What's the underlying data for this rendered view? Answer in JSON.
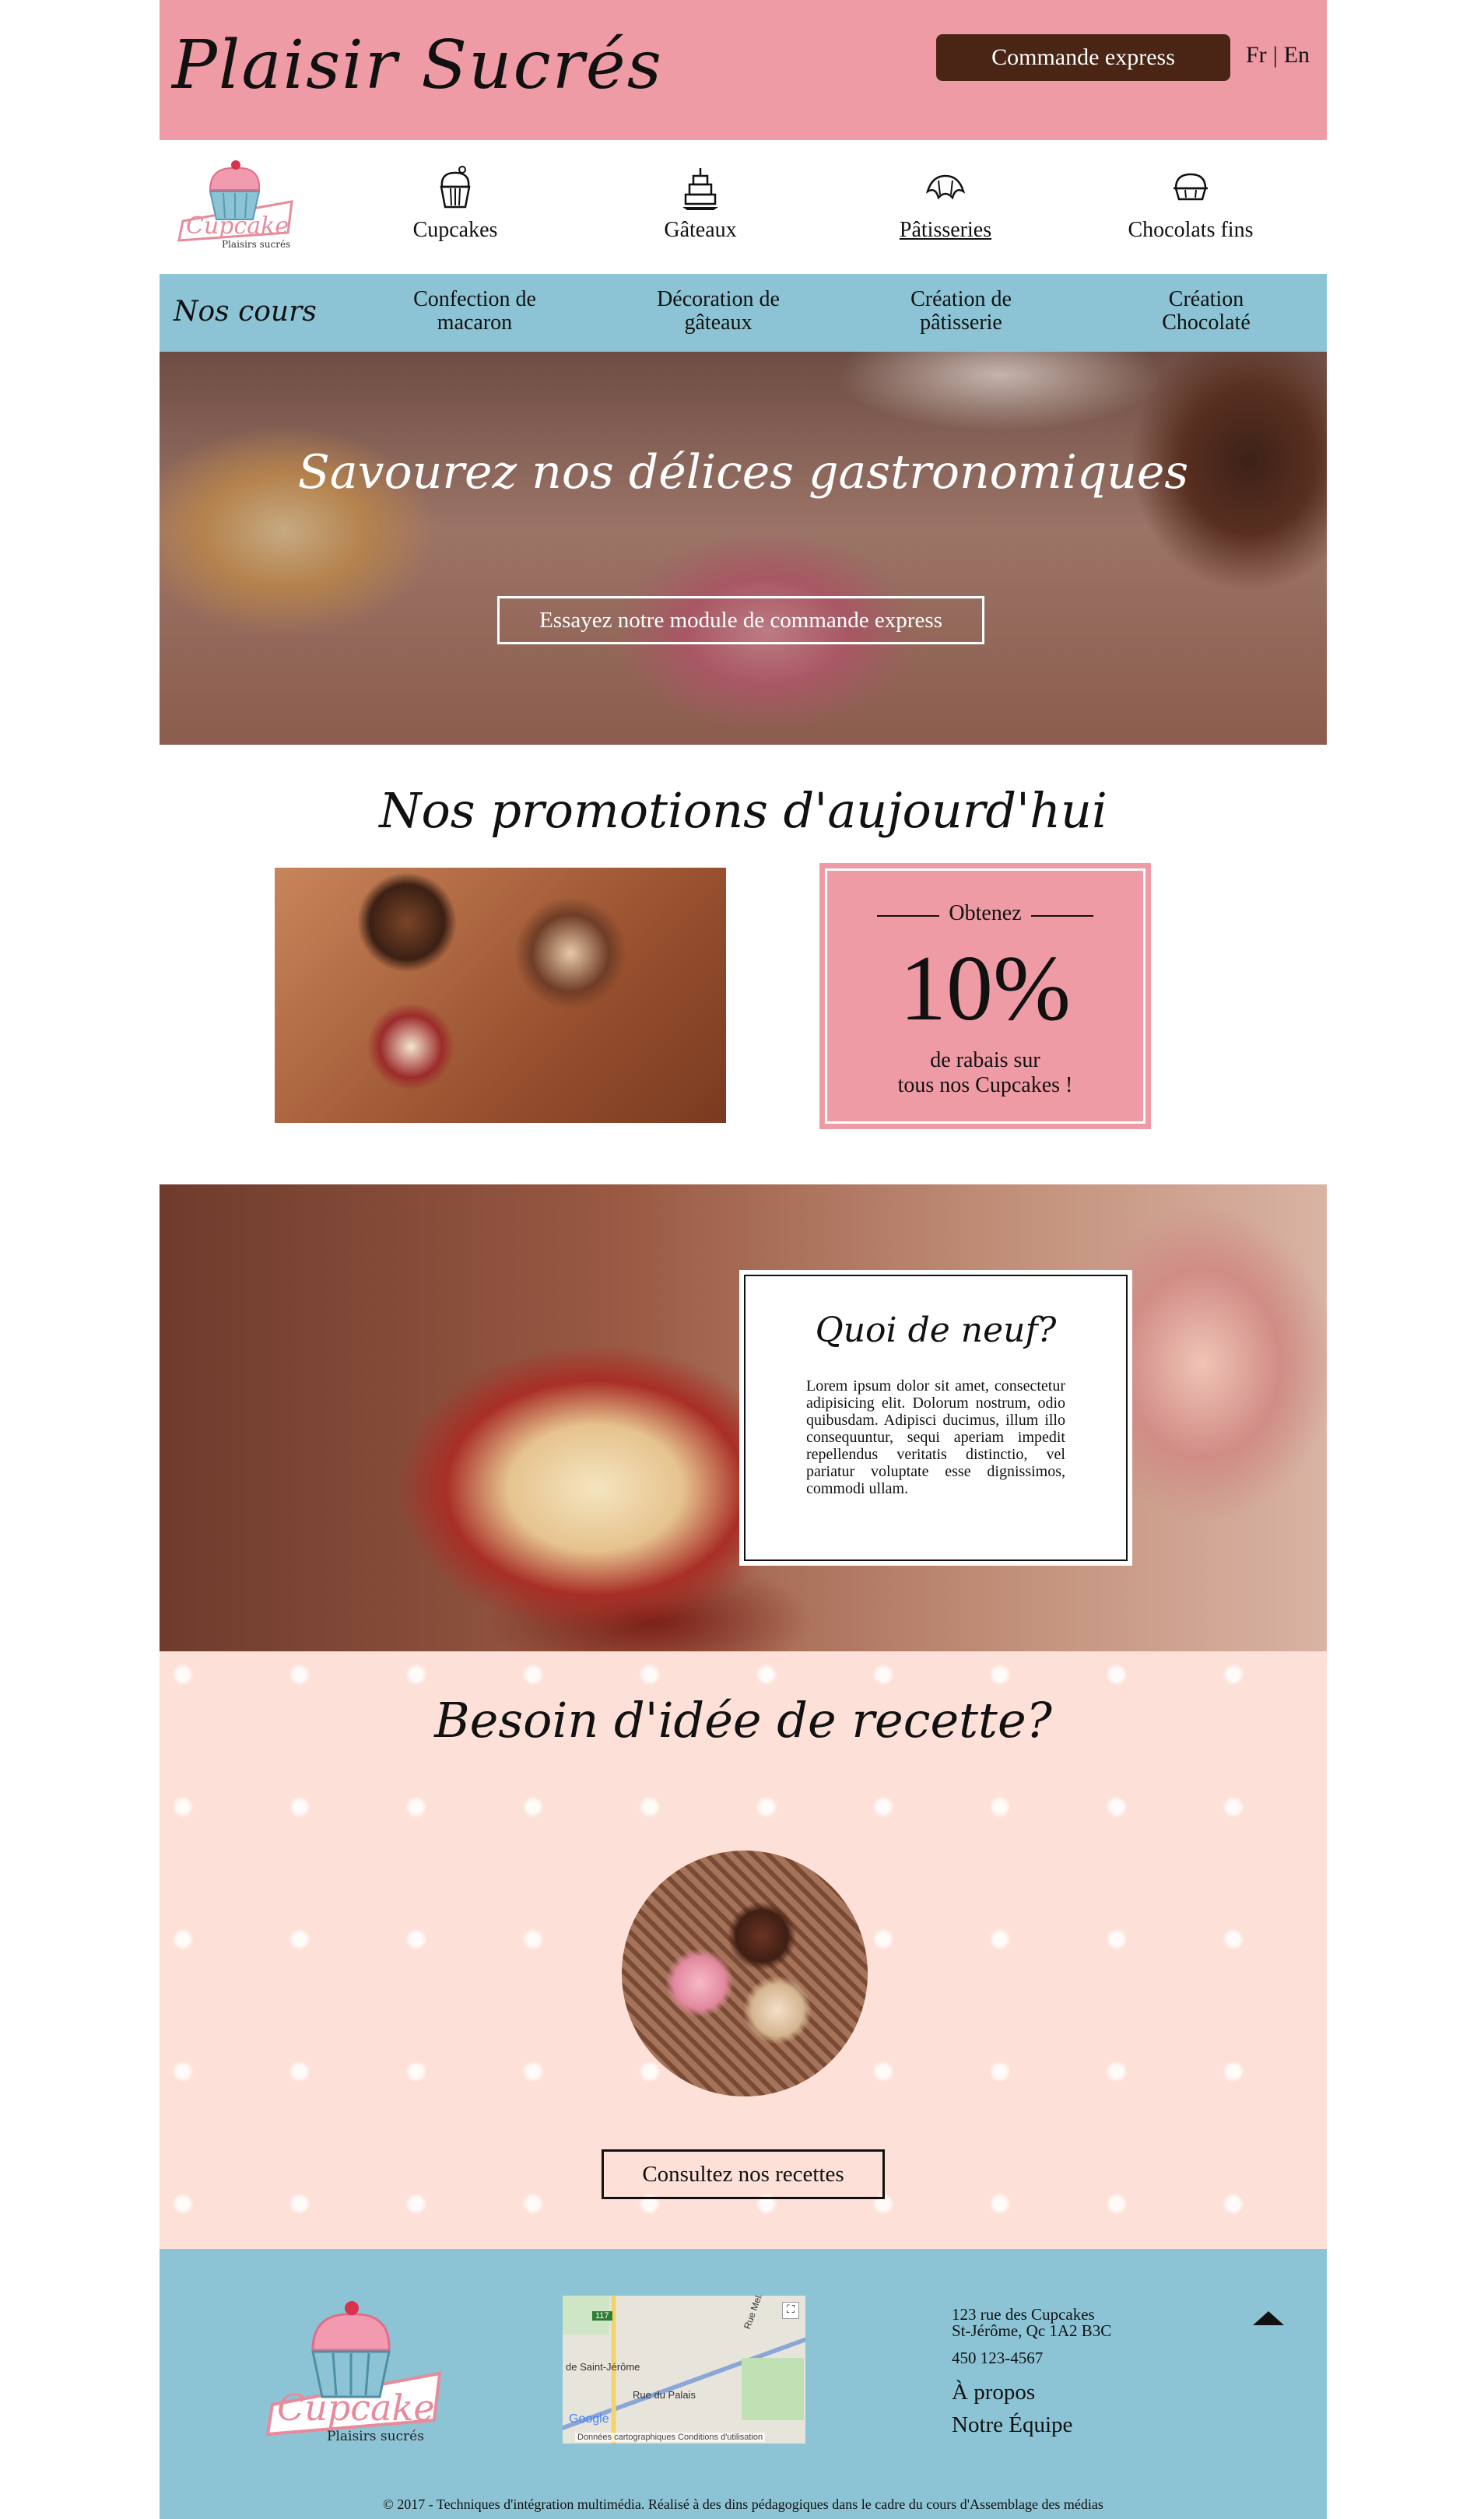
{
  "header": {
    "title": "Plaisir Sucrés",
    "express_button": "Commande express",
    "lang_fr": "Fr",
    "lang_sep": "|",
    "lang_en": "En"
  },
  "logo": {
    "word": "Cupcake",
    "tagline": "Plaisirs sucrés"
  },
  "categories": [
    {
      "label": "Cupcakes",
      "icon": "cupcake-icon"
    },
    {
      "label": "Gâteaux",
      "icon": "cake-icon"
    },
    {
      "label": "Pâtisseries",
      "icon": "croissant-icon",
      "active": true
    },
    {
      "label": "Chocolats fins",
      "icon": "chocolate-icon"
    }
  ],
  "courses": {
    "title": "Nos cours",
    "items": [
      {
        "line1": "Confection de",
        "line2": "macaron"
      },
      {
        "line1": "Décoration de",
        "line2": "gâteaux"
      },
      {
        "line1": "Création de",
        "line2": "pâtisserie"
      },
      {
        "line1": "Création",
        "line2": "Chocolaté"
      }
    ]
  },
  "hero": {
    "title": "Savourez nos délices gastronomiques",
    "button": "Essayez notre module de commande express"
  },
  "promo": {
    "title": "Nos promotions d'aujourd'hui",
    "get": "Obtenez",
    "percent": "10%",
    "desc_line1": "de rabais sur",
    "desc_line2": "tous nos Cupcakes !"
  },
  "news": {
    "title": "Quoi de neuf?",
    "text": "Lorem ipsum dolor sit amet, consectetur adipisicing elit. Dolorum nostrum, odio quibusdam. Adipisci ducimus, illum illo consequuntur, sequi aperiam impedit repellendus veritatis distinctio, vel pariatur voluptate esse dignissimos, commodi ullam."
  },
  "recipes": {
    "title": "Besoin d'idée de recette?",
    "button": "Consultez nos recettes"
  },
  "footer": {
    "map": {
      "label_city": "de Saint-Jérôme",
      "label_street": "Rue du Palais",
      "label_road": "Rue Melançon",
      "route": "117",
      "google": "Google",
      "data_label": "Données cartographiques",
      "terms": "Conditions d'utilisation"
    },
    "address_line1": "123 rue des Cupcakes",
    "address_line2": "St-Jérôme, Qc 1A2 B3C",
    "phone": "450 123-4567",
    "about": "À propos",
    "team": "Notre Équipe",
    "copyright": "© 2017 - Techniques d'intégration multimédia. Réalisé à des dins pédagogiques dans le cadre du cours d'Assemblage des médias"
  },
  "colors": {
    "header_pink": "#ef9ba5",
    "nav_blue": "#8cc4d5",
    "button_brown": "#4a2515",
    "recipes_bg": "#fde1d8"
  }
}
